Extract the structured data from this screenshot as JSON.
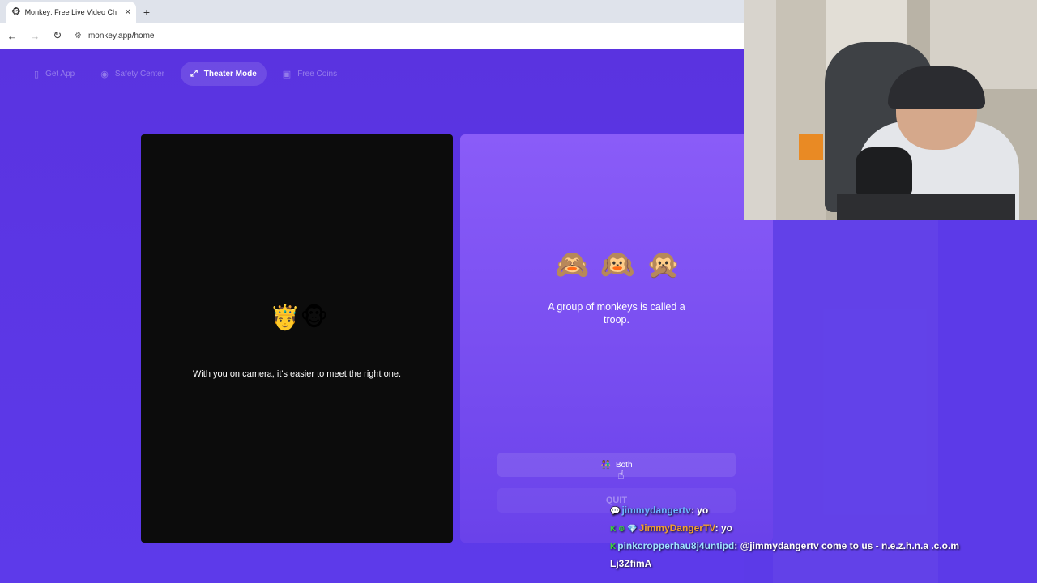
{
  "browser": {
    "tab_title": "Monkey: Free Live Video Ch",
    "tab_favicon": "🐵",
    "tab_close": "✕",
    "new_tab": "+",
    "url": "monkey.app/home"
  },
  "topnav": [
    {
      "label": "Get App",
      "icon": "▯"
    },
    {
      "label": "Safety Center",
      "icon": "◉"
    },
    {
      "label": "Theater Mode",
      "icon": "⤢"
    },
    {
      "label": "Free Coins",
      "icon": "▣"
    }
  ],
  "video": {
    "emoji": "🤴🐵",
    "message": "With you on camera, it's easier to meet the right one."
  },
  "card": {
    "monkeys": [
      "🙈",
      "🙉",
      "🙊"
    ],
    "fact": "A group of monkeys is called a troop.",
    "both_icon": "👫",
    "both_label": "Both",
    "quit_label": "QUIT"
  },
  "chat": [
    {
      "badges": "💬",
      "user": "jimmydangertv",
      "sep": ": ",
      "text": "yo",
      "color_class": "user1"
    },
    {
      "badges": "K ⊕ 💎",
      "user": "JimmyDangerTV",
      "sep": ": ",
      "text": "yo",
      "color_class": "user2"
    },
    {
      "badges": "K",
      "user": "pinkcropperhau8j4untipd",
      "sep": ": ",
      "text": "@jimmydangertv come to us - n.e.z.h.n.a .c.o.m",
      "color_class": "user3"
    },
    {
      "badges": "",
      "user": "",
      "sep": "",
      "text": "Lj3ZfimA",
      "color_class": ""
    }
  ],
  "colors": {
    "page_bg": "#5a36e6",
    "card_top": "#8a5cf8",
    "video_bg": "#0c0c0c"
  }
}
